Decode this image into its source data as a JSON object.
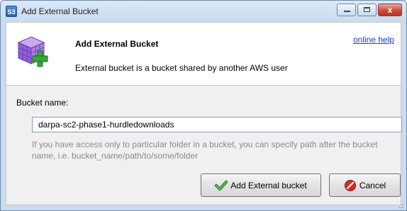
{
  "window": {
    "title": "Add External Bucket",
    "app_icon": "S3"
  },
  "titlebar": {
    "minimize_icon": "minimize-icon",
    "maximize_icon": "maximize-icon",
    "close_icon": "close-icon",
    "close_glyph": "x"
  },
  "header": {
    "title": "Add External Bucket",
    "description": "External bucket is a bucket shared by another AWS user",
    "help_link": "online help",
    "icon": "cube-add-icon"
  },
  "form": {
    "bucket_label": "Bucket name:",
    "bucket_value": "darpa-sc2-phase1-hurdledownloads",
    "hint": "If you have access only to particular folder in a bucket, you can specify path after the bucket name, i.e. bucket_name/path/to/some/folder"
  },
  "buttons": {
    "add_label": "Add External bucket",
    "add_icon": "checkmark-icon",
    "cancel_label": "Cancel",
    "cancel_icon": "no-entry-icon"
  },
  "colors": {
    "link": "#1a3cc8",
    "close_button": "#cf4a39",
    "add_icon": "#3aa53a",
    "cancel_icon": "#d42a2a"
  }
}
